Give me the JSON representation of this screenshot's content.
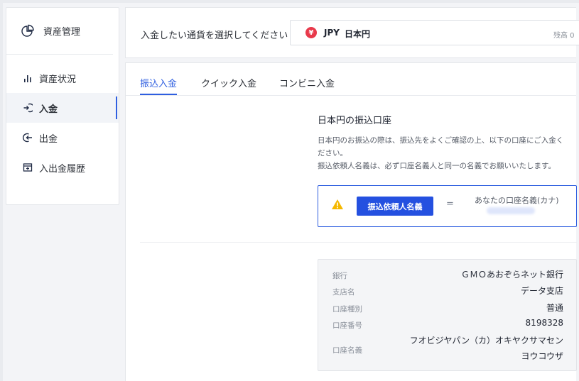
{
  "sidebar": {
    "header": "資産管理",
    "items": [
      {
        "label": "資産状況",
        "icon": "bar-chart-icon",
        "active": false
      },
      {
        "label": "入金",
        "icon": "deposit-icon",
        "active": true
      },
      {
        "label": "出金",
        "icon": "withdraw-icon",
        "active": false
      },
      {
        "label": "入出金履歴",
        "icon": "history-icon",
        "active": false
      }
    ]
  },
  "currency": {
    "prompt": "入金したい通貨を選択してください",
    "symbol": "¥",
    "code": "JPY",
    "name": "日本円",
    "balance_label": "残高 0"
  },
  "tabs": [
    {
      "label": "振込入金",
      "active": true
    },
    {
      "label": "クイック入金",
      "active": false
    },
    {
      "label": "コンビニ入金",
      "active": false
    }
  ],
  "transfer": {
    "title": "日本円の振込口座",
    "desc_line1": "日本円のお振込の際は、振込先をよくご確認の上、以下の口座にご入金く",
    "desc_line2": "ださい。",
    "desc_line3": "振込依頼人名義は、必ず口座名義人と同一の名義でお願いいたします。",
    "name_button": "振込依頼人名義",
    "equals": "=",
    "kana_label": "あなたの口座名義(カナ)"
  },
  "bank": {
    "bank_label": "銀行",
    "bank_value": "ＧＭＯあおぞらネット銀行",
    "branch_label": "支店名",
    "branch_value": "データ支店",
    "type_label": "口座種別",
    "type_value": "普通",
    "number_label": "口座番号",
    "number_value": "8198328",
    "holder_label": "口座名義",
    "holder_line1": "フオビジヤパン（カ）オキヤクサマセン",
    "holder_line2": "ヨウコウザ"
  },
  "colors": {
    "accent": "#2f5fe0",
    "button": "#2450e0",
    "yen_badge": "#e8394b",
    "warning": "#f5b800"
  }
}
